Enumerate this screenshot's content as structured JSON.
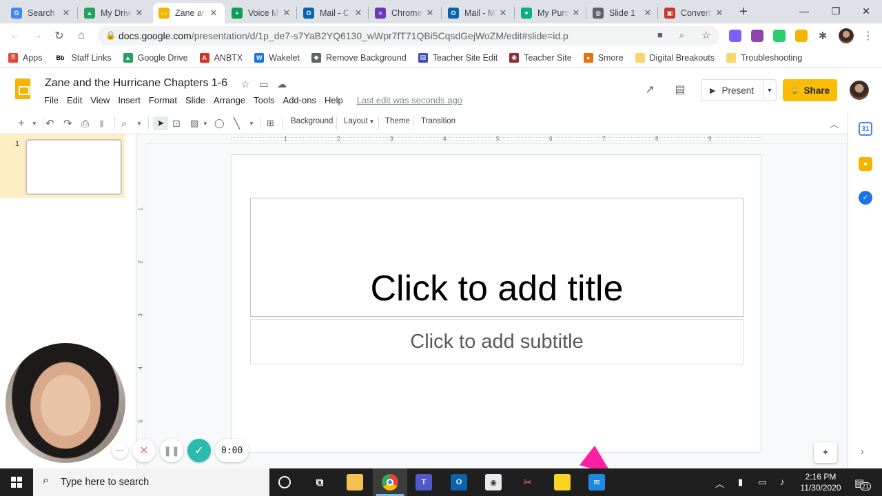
{
  "tabs": [
    {
      "title": "Search",
      "fav_color": "#4285f4",
      "fav_glyph": "G"
    },
    {
      "title": "My Drive",
      "fav_color": "#1fa463",
      "fav_glyph": "▲"
    },
    {
      "title": "Zane and",
      "fav_color": "#f4b400",
      "fav_glyph": "▭"
    },
    {
      "title": "Voice M",
      "fav_color": "#0f9d58",
      "fav_glyph": "+"
    },
    {
      "title": "Mail - C",
      "fav_color": "#0a64ad",
      "fav_glyph": "O"
    },
    {
      "title": "Chrome",
      "fav_color": "#673ab7",
      "fav_glyph": "≡"
    },
    {
      "title": "Mail - M",
      "fav_color": "#0a64ad",
      "fav_glyph": "O"
    },
    {
      "title": "My Purc",
      "fav_color": "#0bb07b",
      "fav_glyph": "♥"
    },
    {
      "title": "Slide 1",
      "fav_color": "#5f6368",
      "fav_glyph": "◍"
    },
    {
      "title": "Convert",
      "fav_color": "#c0392b",
      "fav_glyph": "▣"
    }
  ],
  "browser": {
    "url_host": "docs.google.com",
    "url_path": "/presentation/d/1p_de7-s7YaB2YQ6130_wWpr7fT71QBi5CqsdGejWoZM/edit#slide=id.p"
  },
  "bookmarks": [
    {
      "label": "Apps",
      "color": "#ea4335",
      "glyph": "⠿"
    },
    {
      "label": "Staff Links",
      "color": "#000000",
      "glyph": "Bb"
    },
    {
      "label": "Google Drive",
      "color": "#1fa463",
      "glyph": "▲"
    },
    {
      "label": "ANBTX",
      "color": "#d93025",
      "glyph": "A"
    },
    {
      "label": "Wakelet",
      "color": "#1a73e8",
      "glyph": "W"
    },
    {
      "label": "Remove Background",
      "color": "#5f6368",
      "glyph": "◆"
    },
    {
      "label": "Teacher Site Edit",
      "color": "#3f51b5",
      "glyph": "▤"
    },
    {
      "label": "Teacher Site",
      "color": "#8e2e2e",
      "glyph": "◉"
    },
    {
      "label": "Smore",
      "color": "#e8710a",
      "glyph": "●"
    },
    {
      "label": "Digital Breakouts",
      "color": "#f9d66b",
      "glyph": ""
    },
    {
      "label": "Troubleshooting",
      "color": "#f9d66b",
      "glyph": ""
    }
  ],
  "doc": {
    "title": "Zane and the Hurricane Chapters 1-6",
    "menus": [
      "File",
      "Edit",
      "View",
      "Insert",
      "Format",
      "Slide",
      "Arrange",
      "Tools",
      "Add-ons",
      "Help"
    ],
    "last_edit": "Last edit was seconds ago",
    "present_label": "Present",
    "share_label": "Share"
  },
  "toolbar": {
    "background": "Background",
    "layout": "Layout",
    "theme": "Theme",
    "transition": "Transition"
  },
  "filmstrip": {
    "slide_number": "1"
  },
  "ruler": {
    "h": [
      "1",
      "2",
      "3",
      "4",
      "5",
      "6",
      "7",
      "8",
      "9"
    ],
    "v": [
      "1",
      "2",
      "3",
      "4",
      "5"
    ]
  },
  "slide": {
    "title_placeholder": "Click to add title",
    "subtitle_placeholder": "Click to add subtitle"
  },
  "recorder": {
    "time": "0:00"
  },
  "taskbar": {
    "search_placeholder": "Type here to search",
    "time": "2:16 PM",
    "date": "11/30/2020",
    "notification_count": "21"
  }
}
